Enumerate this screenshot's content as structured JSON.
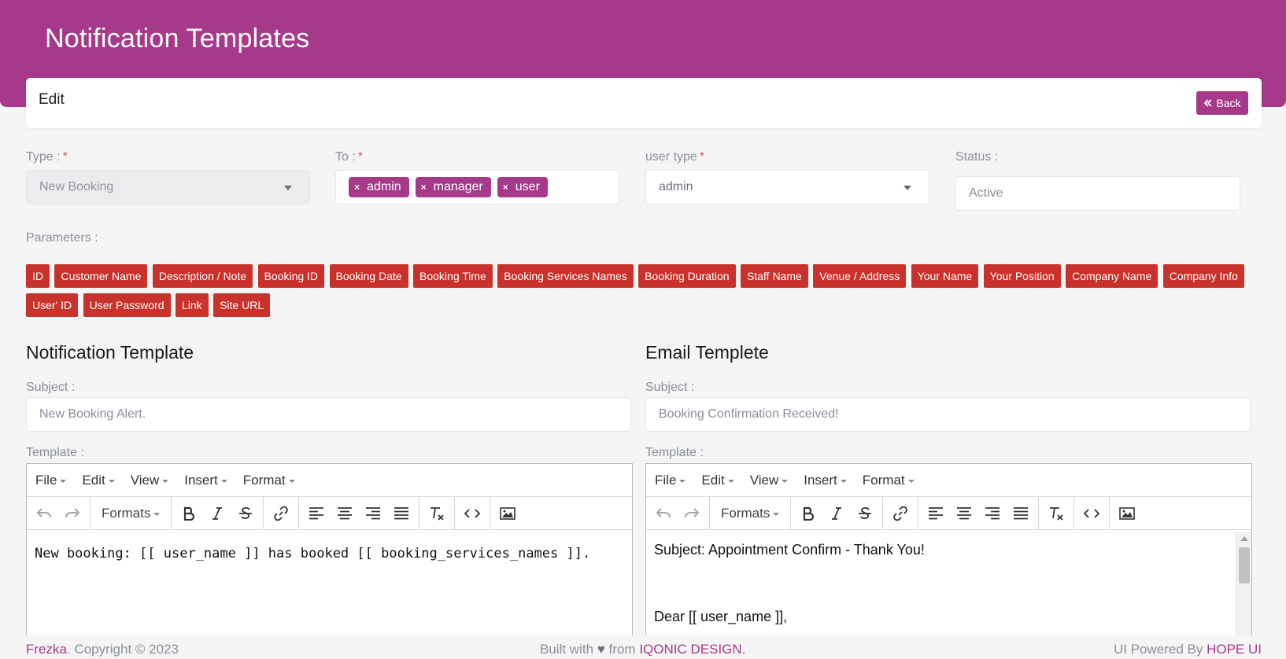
{
  "page": {
    "title": "Notification Templates"
  },
  "card": {
    "title": "Edit",
    "back_label": "Back",
    "back_icon": "double-chevron-left-icon"
  },
  "form": {
    "type": {
      "label": "Type :",
      "required": "*",
      "value": "New Booking"
    },
    "to": {
      "label": "To :",
      "required": "*",
      "tags": [
        "admin",
        "manager",
        "user"
      ],
      "remove_glyph": "×"
    },
    "user_type": {
      "label": "user type",
      "required": "*",
      "value": "admin"
    },
    "status": {
      "label": "Status :",
      "value": "Active"
    }
  },
  "parameters": {
    "label": "Parameters :",
    "items": [
      "ID",
      "Customer Name",
      "Description / Note",
      "Booking ID",
      "Booking Date",
      "Booking Time",
      "Booking Services Names",
      "Booking Duration",
      "Staff Name",
      "Venue / Address",
      "Your Name",
      "Your Position",
      "Company Name",
      "Company Info",
      "User' ID",
      "User Password",
      "Link",
      "Site URL"
    ]
  },
  "notification": {
    "title": "Notification Template",
    "subject_label": "Subject :",
    "subject_value": "New Booking Alert.",
    "template_label": "Template :",
    "content": "New booking: [[ user_name ]] has booked [[ booking_services_names ]]."
  },
  "email": {
    "title": "Email Templete",
    "subject_label": "Subject :",
    "subject_value": "Booking Confirmation Received!",
    "template_label": "Template :",
    "content_line1": "Subject: Appointment Confirm - Thank You!",
    "content_line2": "Dear [[ user_name ]],"
  },
  "editor": {
    "menus": [
      "File",
      "Edit",
      "View",
      "Insert",
      "Format"
    ],
    "formats_label": "Formats"
  },
  "footer": {
    "brand": "Frezka",
    "copyright": ". Copyright © 2023",
    "built_with": "Built with",
    "heart": "♥",
    "from": "from",
    "company": "IQONIC DESIGN",
    "period": ".",
    "powered_by": "UI Powered By",
    "ui": "HOPE UI"
  },
  "colors": {
    "brand": "#a7398b",
    "param_tag": "#c8322b",
    "background": "#f5f5f6"
  }
}
